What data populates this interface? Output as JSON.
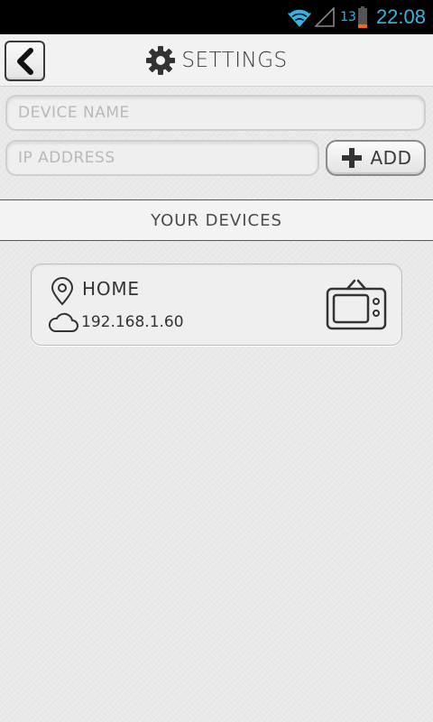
{
  "status_bar": {
    "battery_level": "13",
    "time": "22:08",
    "accent_color": "#33b5e5"
  },
  "header": {
    "title": "SETTINGS",
    "icons": {
      "back": "chevron-left-icon",
      "settings": "gear-icon"
    }
  },
  "form": {
    "device_name_placeholder": "DEVICE NAME",
    "device_name_value": "",
    "ip_address_placeholder": "IP ADDRESS",
    "ip_address_value": "",
    "add_label": "ADD"
  },
  "devices_section": {
    "title": "YOUR DEVICES",
    "devices": [
      {
        "name": "HOME",
        "ip": "192.168.1.60",
        "icon": "tv-icon"
      }
    ]
  }
}
